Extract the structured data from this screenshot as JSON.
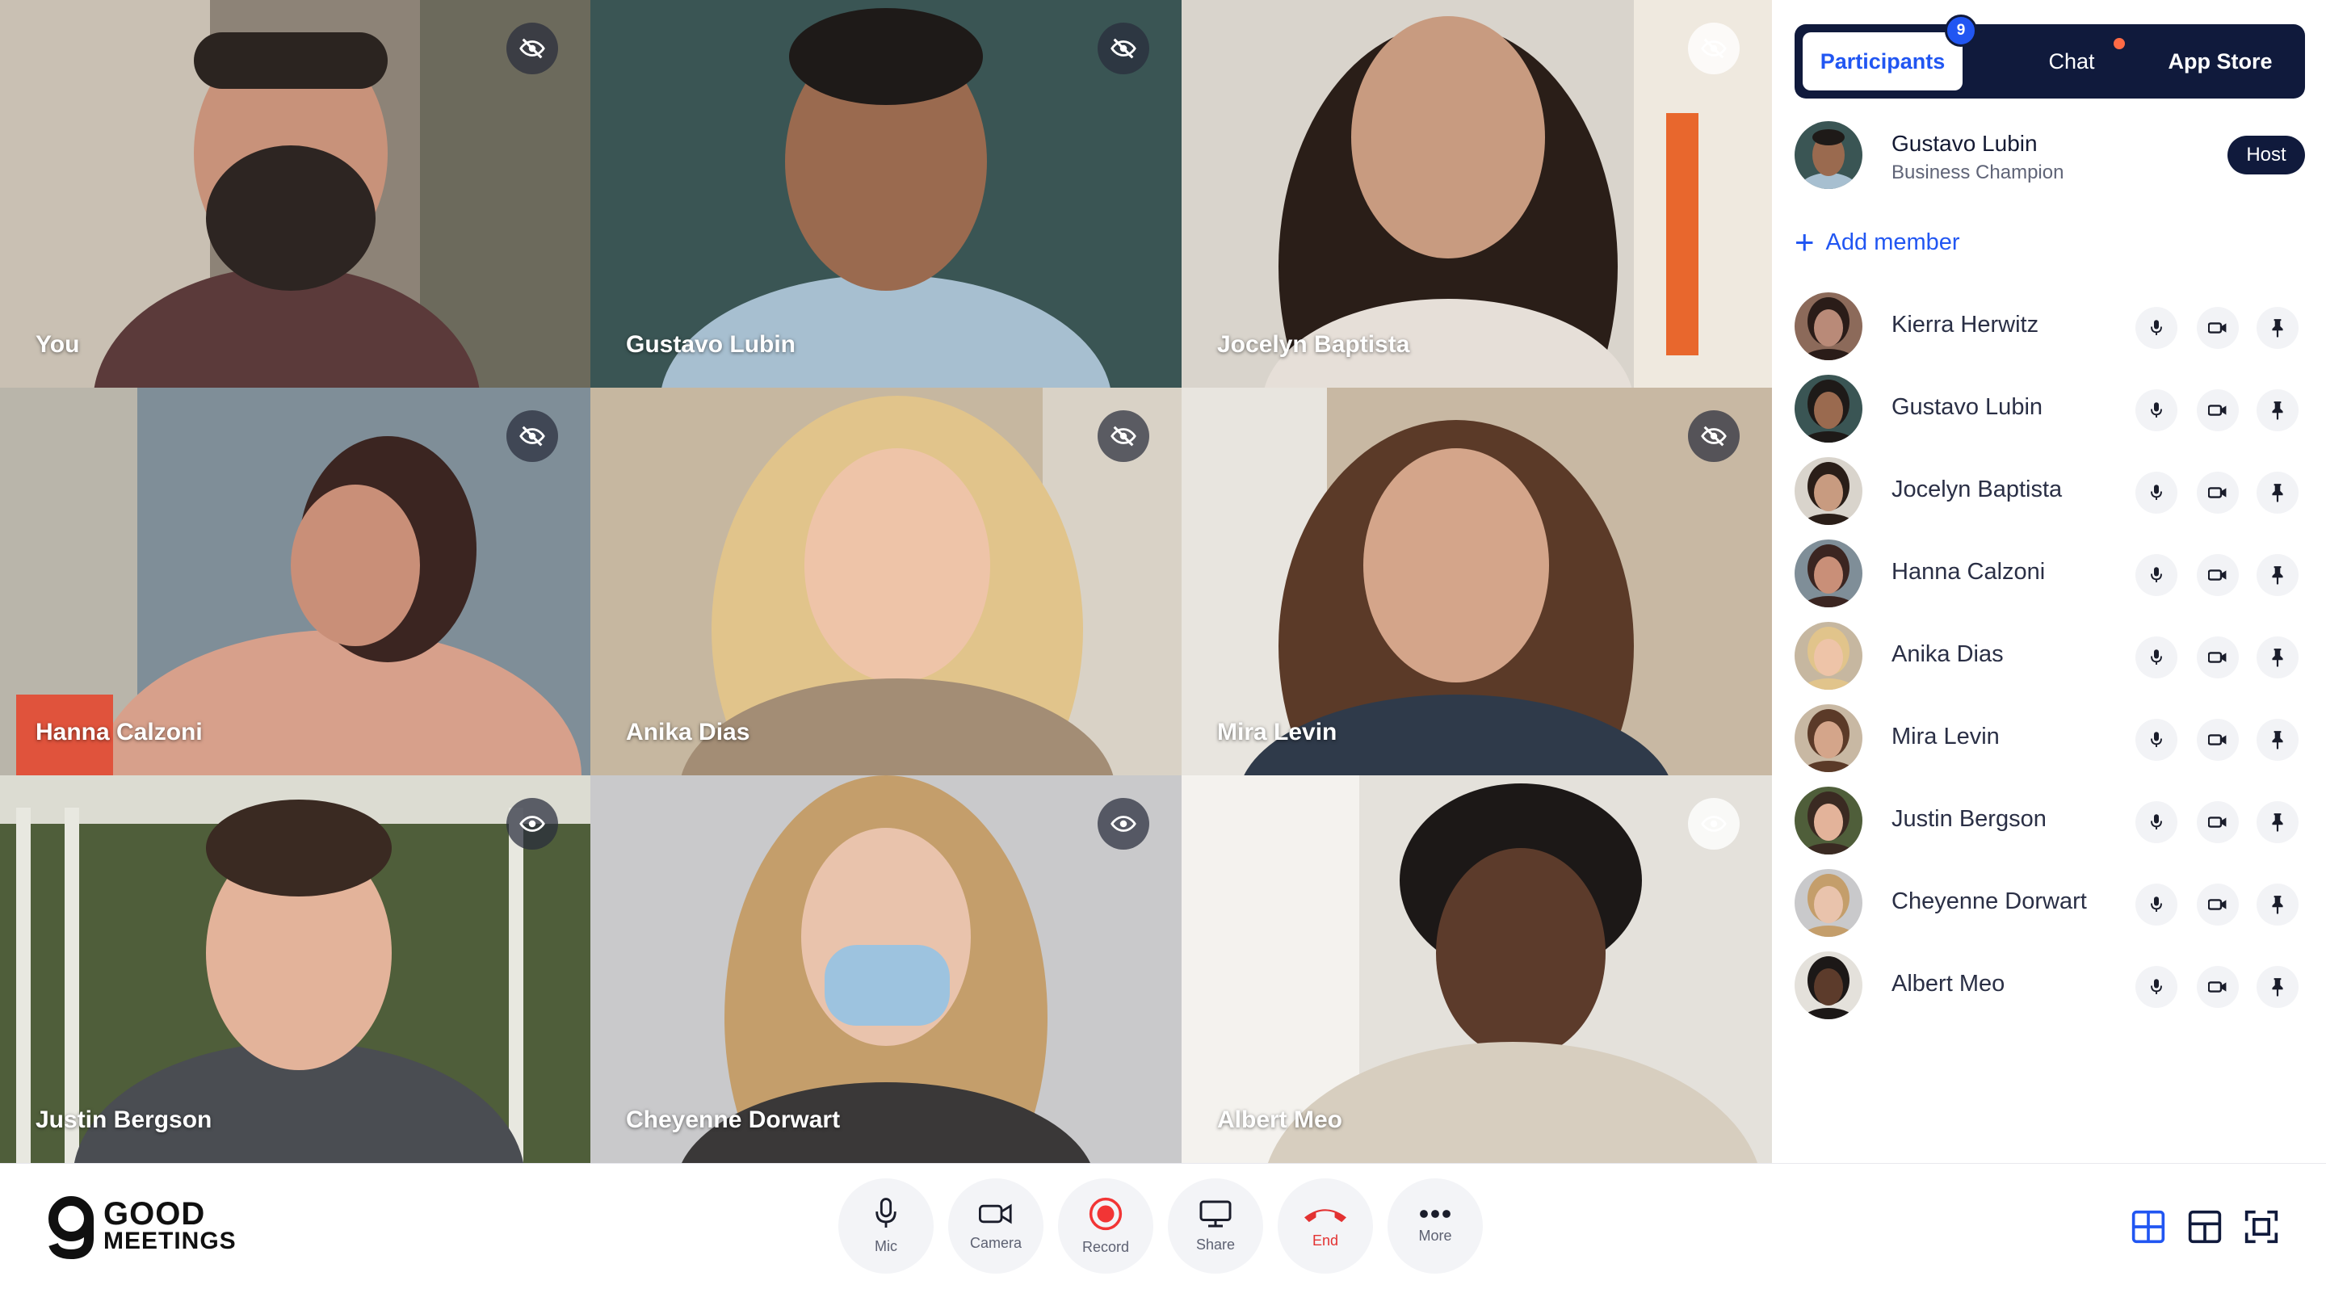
{
  "colors": {
    "accent": "#2156f2",
    "navy": "#101a3c",
    "end_red": "#e33232",
    "record_red": "#f23535",
    "chat_dot": "#ff6a45"
  },
  "tiles": [
    {
      "name": "You",
      "eye": "eye-off"
    },
    {
      "name": "Gustavo Lubin",
      "eye": "eye-off"
    },
    {
      "name": "Jocelyn Baptista",
      "eye": "eye-off"
    },
    {
      "name": "Hanna Calzoni",
      "eye": "eye-off"
    },
    {
      "name": "Anika Dias",
      "eye": "eye-off"
    },
    {
      "name": "Mira Levin",
      "eye": "eye-off"
    },
    {
      "name": "Justin Bergson",
      "eye": "eye"
    },
    {
      "name": "Cheyenne Dorwart",
      "eye": "eye"
    },
    {
      "name": "Albert Meo",
      "eye": "eye"
    }
  ],
  "panel": {
    "tabs": {
      "participants": "Participants",
      "participants_count": "9",
      "chat": "Chat",
      "app_store": "App Store"
    },
    "host": {
      "name": "Gustavo Lubin",
      "role": "Business Champion",
      "badge": "Host"
    },
    "add_member": "Add member",
    "participants": [
      "Kierra Herwitz",
      "Gustavo Lubin",
      "Jocelyn Baptista",
      "Hanna Calzoni",
      "Anika Dias",
      "Mira Levin",
      "Justin Bergson",
      "Cheyenne Dorwart",
      "Albert Meo"
    ]
  },
  "brand": {
    "line1": "GOOD",
    "line2": "MEETINGS"
  },
  "toolbar": {
    "mic": "Mic",
    "camera": "Camera",
    "record": "Record",
    "share": "Share",
    "end": "End",
    "more": "More"
  },
  "view_icons": [
    "grid-view-icon",
    "speaker-view-icon",
    "fullscreen-view-icon"
  ]
}
